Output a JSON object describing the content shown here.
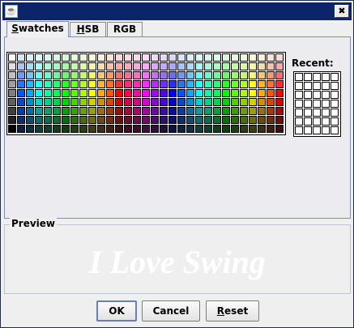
{
  "window": {
    "close_glyph": "✖",
    "app_icon": "java-icon"
  },
  "tabs": [
    {
      "mnemonic": "S",
      "rest": "watches",
      "selected": true
    },
    {
      "mnemonic": "H",
      "rest": "SB",
      "selected": false
    },
    {
      "mnemonic": "",
      "rest": "RGB",
      "selected": false
    }
  ],
  "recent": {
    "label": "Recent:",
    "rows": 7,
    "cols": 5
  },
  "preview": {
    "title": "Preview",
    "sample_text": "I Love Swing",
    "sample_color": "#ffffff"
  },
  "buttons": {
    "ok": {
      "label": "OK"
    },
    "cancel": {
      "label": "Cancel"
    },
    "reset": {
      "mnemonic": "R",
      "rest": "eset"
    }
  },
  "swatches": {
    "rows": 9,
    "cols": 31,
    "hue_sequence": [
      240,
      220,
      200,
      180,
      160,
      140,
      120,
      100,
      80,
      60,
      40,
      20,
      0,
      340,
      320,
      300,
      280,
      260,
      240,
      220,
      200,
      180,
      160,
      140,
      120,
      100,
      80,
      60,
      40,
      20,
      0
    ],
    "tint_rows": [
      0.95,
      0.8,
      0.6,
      0.45,
      0.5,
      0.5,
      0.4,
      0.28,
      0.15
    ]
  }
}
